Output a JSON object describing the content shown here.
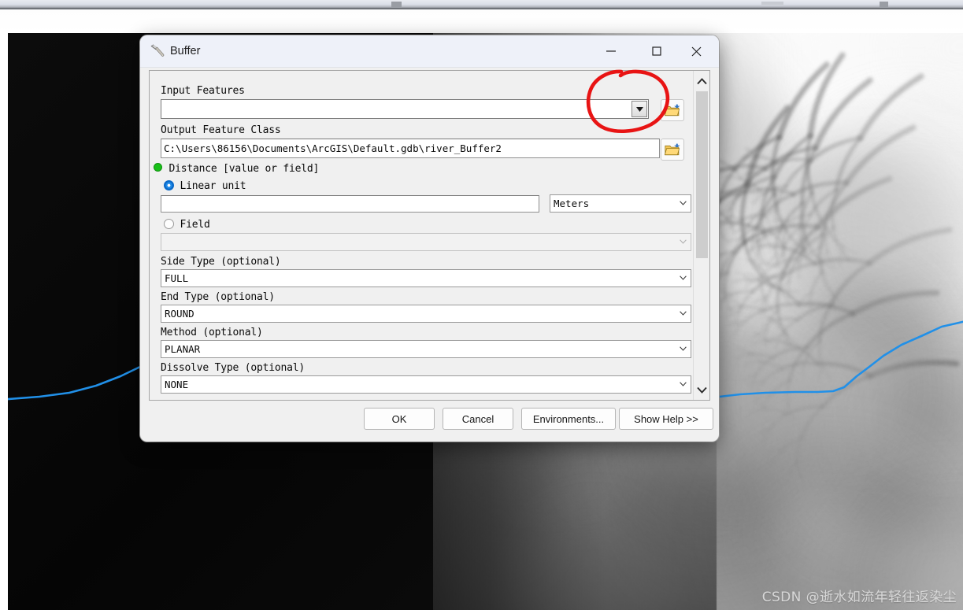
{
  "window": {
    "title": "Buffer",
    "icon": "hammer-icon",
    "controls": {
      "minimize": "—",
      "maximize": "□",
      "close": "✕"
    }
  },
  "form": {
    "input_features": {
      "label": "Input Features",
      "value": "",
      "placeholder": "",
      "browse_icon": "folder-browse-icon",
      "dropdown_icon": "dropdown-arrow-icon"
    },
    "output_feature_class": {
      "label": "Output Feature Class",
      "value": "C:\\Users\\86156\\Documents\\ArcGIS\\Default.gdb\\river_Buffer2",
      "browse_icon": "folder-browse-icon"
    },
    "distance": {
      "label": "Distance [value or field]",
      "required_marker": "green-dot-required-icon",
      "linear_unit": {
        "label": "Linear unit",
        "selected": true,
        "value": "",
        "unit": "Meters",
        "unit_options": [
          "Meters"
        ]
      },
      "field": {
        "label": "Field",
        "selected": false,
        "value": "",
        "disabled": true
      }
    },
    "side_type": {
      "label": "Side Type (optional)",
      "value": "FULL"
    },
    "end_type": {
      "label": "End Type (optional)",
      "value": "ROUND"
    },
    "method": {
      "label": "Method (optional)",
      "value": "PLANAR"
    },
    "dissolve_type": {
      "label": "Dissolve Type (optional)",
      "value": "NONE"
    }
  },
  "scrollbar": {
    "up_icon": "chevron-up-icon",
    "down_icon": "chevron-down-icon"
  },
  "buttons": {
    "ok": "OK",
    "cancel": "Cancel",
    "environments": "Environments...",
    "show_help": "Show Help >>"
  },
  "map": {
    "river_color": "#2190e8",
    "watermark": "CSDN @逝水如流年轻往返染尘"
  },
  "annotation": {
    "shape": "hand-drawn-red-circle",
    "color": "#e81414"
  }
}
